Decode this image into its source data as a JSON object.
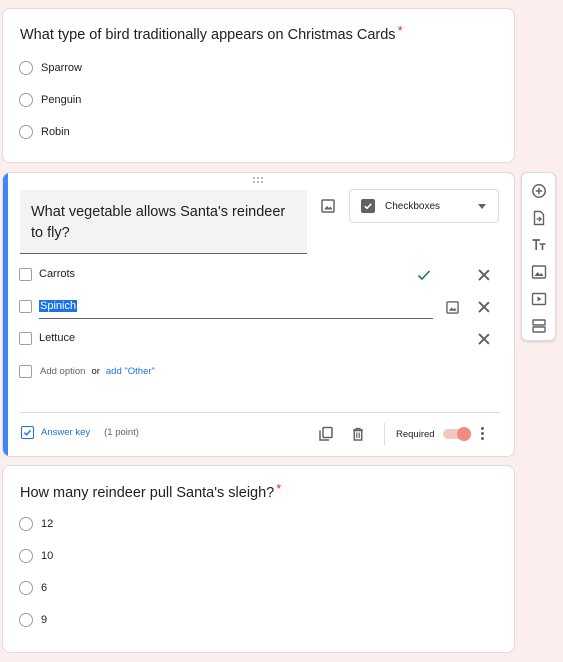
{
  "question1": {
    "title": "What type of bird traditionally appears on Christmas Cards",
    "required_mark": "*",
    "options": [
      "Sparrow",
      "Penguin",
      "Robin"
    ]
  },
  "question2": {
    "title": "What vegetable allows Santa's reindeer to fly?",
    "type_selector": {
      "icon": "checkbox-icon",
      "selected": "Checkboxes"
    },
    "options": [
      {
        "label": "Carrots",
        "correct": true
      },
      {
        "label": "Spinich",
        "editing": true,
        "selected_text": true
      },
      {
        "label": "Lettuce"
      }
    ],
    "add_option": "Add option",
    "or": "or",
    "add_other": "add \"Other\"",
    "footer": {
      "answer_key": "Answer key",
      "points": "(1 point)",
      "required_label": "Required",
      "required_on": true
    },
    "colors": {
      "accent": "#4285f4",
      "link": "#1a73e8",
      "correct": "#188038",
      "toggle": "#ef8b80"
    }
  },
  "question3": {
    "title": "How many reindeer pull Santa's sleigh?",
    "required_mark": "*",
    "options": [
      "12",
      "10",
      "6",
      "9"
    ]
  },
  "toolbar": {
    "items": [
      "add-question-icon",
      "import-questions-icon",
      "add-title-icon",
      "add-image-icon",
      "add-video-icon",
      "add-section-icon"
    ]
  }
}
